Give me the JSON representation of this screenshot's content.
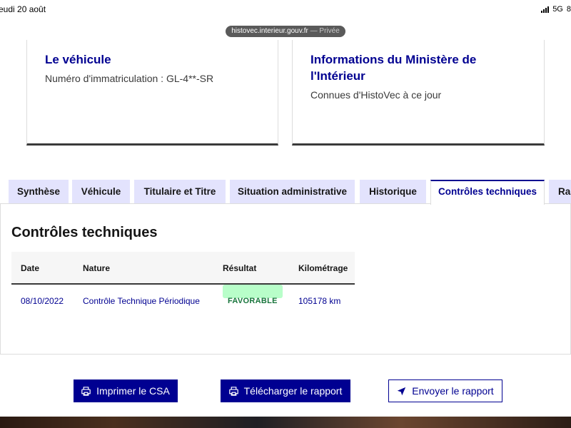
{
  "status_bar": {
    "date": "eudi 20 août",
    "network": "5G",
    "battery": "8"
  },
  "browser": {
    "domain": "histovec.interieur.gouv.fr",
    "mode": " — Privée"
  },
  "cards": [
    {
      "title": "Le véhicule",
      "text": "Numéro d'immatriculation : GL-4**-SR"
    },
    {
      "title_line1": "Informations du Ministère de",
      "title_line2": "l'Intérieur",
      "text": "Connues d'HistoVec à ce jour"
    }
  ],
  "tabs": [
    {
      "label": "Synthèse"
    },
    {
      "label": "Véhicule"
    },
    {
      "label": "Titulaire et Titre"
    },
    {
      "label": "Situation administrative"
    },
    {
      "label": "Historique"
    },
    {
      "label": "Contrôles techniques",
      "active": true
    },
    {
      "label": "Rap"
    }
  ],
  "panel": {
    "title": "Contrôles techniques",
    "columns": [
      "Date",
      "Nature",
      "Résultat",
      "Kilométrage"
    ],
    "rows": [
      {
        "date": "08/10/2022",
        "nature": "Contrôle Technique Périodique",
        "result": "FAVORABLE",
        "km": "105178 km"
      }
    ]
  },
  "actions": {
    "print": "Imprimer le CSA",
    "download": "Télécharger le rapport",
    "send": "Envoyer le rapport"
  },
  "colors": {
    "brand_blue": "#000091",
    "tab_bg": "#e3e3fd",
    "success_bg": "#b8fec9",
    "success_text": "#18753c"
  },
  "icons": {
    "print": "printer-icon",
    "download": "printer-icon",
    "send": "send-arrow-icon"
  }
}
